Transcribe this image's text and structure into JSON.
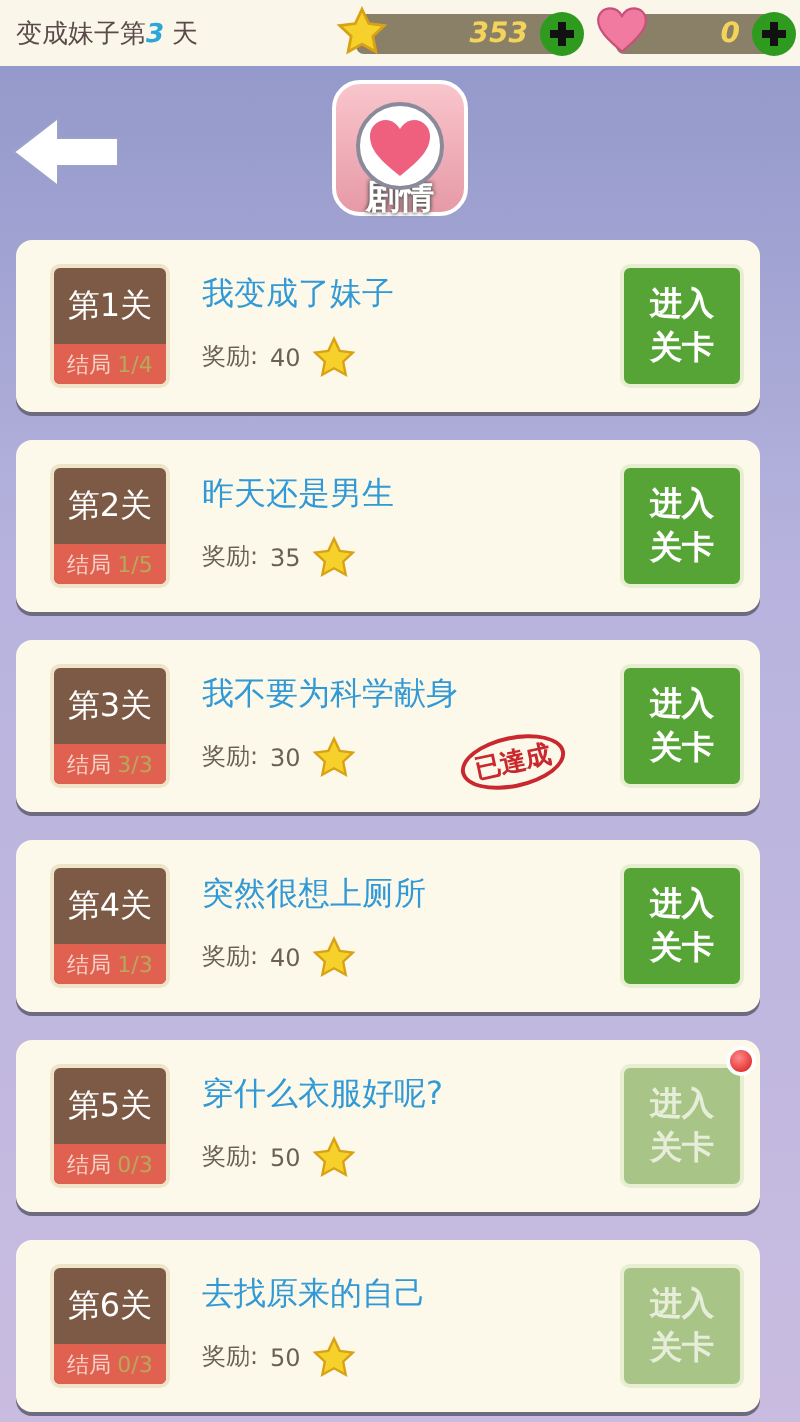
{
  "status": {
    "day_prefix": "变成妹子第",
    "day": "3",
    "day_suffix": "天",
    "stars": "353",
    "hearts": "0"
  },
  "header": {
    "title": "剧情"
  },
  "levels": [
    {
      "label": "第1关",
      "ending_label": "结局",
      "ending": "1/4",
      "title": "我变成了妹子",
      "reward_label": "奖励:",
      "reward": "40",
      "button": "进入关卡",
      "disabled": false,
      "notice": false
    },
    {
      "label": "第2关",
      "ending_label": "结局",
      "ending": "1/5",
      "title": "昨天还是男生",
      "reward_label": "奖励:",
      "reward": "35",
      "button": "进入关卡",
      "disabled": false,
      "notice": false
    },
    {
      "label": "第3关",
      "ending_label": "结局",
      "ending": "3/3",
      "title": "我不要为科学献身",
      "reward_label": "奖励:",
      "reward": "30",
      "button": "进入关卡",
      "disabled": false,
      "notice": false,
      "stamp": "已達成"
    },
    {
      "label": "第4关",
      "ending_label": "结局",
      "ending": "1/3",
      "title": "突然很想上厕所",
      "reward_label": "奖励:",
      "reward": "40",
      "button": "进入关卡",
      "disabled": false,
      "notice": false
    },
    {
      "label": "第5关",
      "ending_label": "结局",
      "ending": "0/3",
      "title": "穿什么衣服好呢?",
      "reward_label": "奖励:",
      "reward": "50",
      "button": "进入关卡",
      "disabled": true,
      "notice": true
    },
    {
      "label": "第6关",
      "ending_label": "结局",
      "ending": "0/3",
      "title": "去找原来的自己",
      "reward_label": "奖励:",
      "reward": "50",
      "button": "进入关卡",
      "disabled": true,
      "notice": false
    }
  ]
}
